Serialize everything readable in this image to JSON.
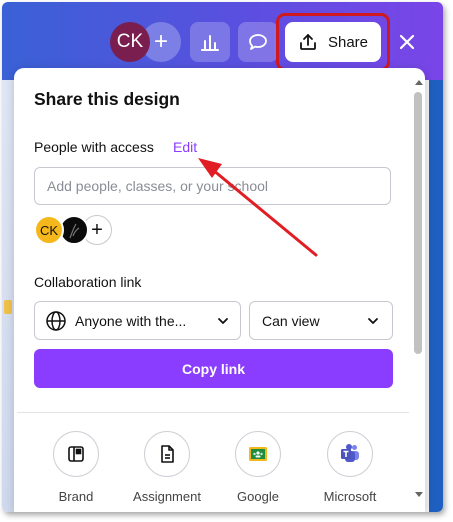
{
  "header": {
    "avatar_initials": "CK",
    "add_collaborator_symbol": "+",
    "share_label": "Share"
  },
  "share_panel": {
    "title": "Share this design",
    "people_with_access_label": "People with access",
    "edit_link": "Edit",
    "people_input": {
      "placeholder": "Add people, classes, or your school",
      "value": ""
    },
    "collaborators": [
      {
        "initials": "CK",
        "color": "#f5b81c"
      },
      {
        "initials": "",
        "color": "#0b0b0b"
      }
    ],
    "add_person_symbol": "+",
    "collaboration_link_label": "Collaboration link",
    "link_access_select": "Anyone with the...",
    "permission_select": "Can view",
    "copy_link_label": "Copy link",
    "share_options": [
      {
        "label": "Brand",
        "icon": "brand-template-icon"
      },
      {
        "label": "Assignment",
        "icon": "assignment-icon"
      },
      {
        "label": "Google",
        "icon": "google-classroom-icon"
      },
      {
        "label": "Microsoft",
        "icon": "microsoft-teams-icon"
      }
    ]
  },
  "colors": {
    "accent": "#8b3dff",
    "highlight": "#d0191f",
    "topbar_start": "#3a61d6",
    "topbar_end": "#7a45e8"
  }
}
